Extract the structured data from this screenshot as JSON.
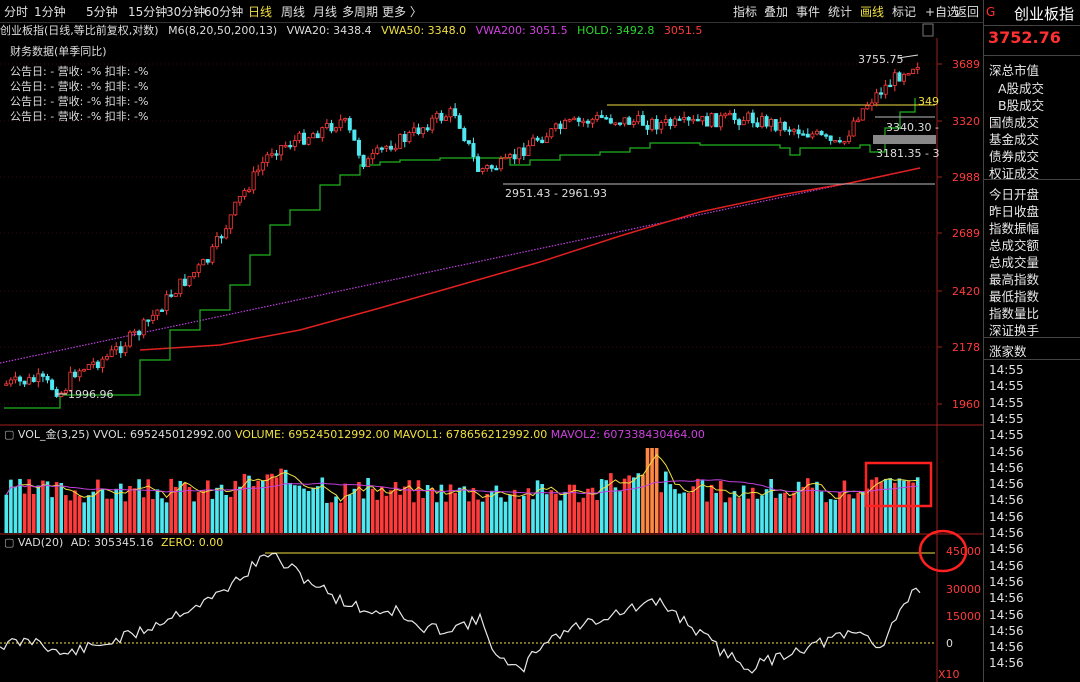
{
  "toolbar": {
    "periods": [
      "分时",
      "1分钟",
      "5分钟",
      "15分钟",
      "30分钟",
      "60分钟",
      "日线",
      "周线",
      "月线",
      "多周期",
      "更多 〉"
    ],
    "active_period": "日线",
    "right_items": [
      "指标",
      "叠加",
      "事件",
      "统计",
      "画线",
      "标记",
      "+自选",
      "返回"
    ],
    "active_right": "画线"
  },
  "main_chart": {
    "name": "创业板指(日线,等比前复权,对数)",
    "indicator": "M6(8,20,50,200,13)",
    "vwa20": "VWA20: 3438.4",
    "vwa50": "VWA50: 3348.0",
    "vwa200": "VWA200: 3051.5",
    "hold": "HOLD: 3492.8",
    "hold_extra": "3051.5",
    "fin_title": "财务数据(单季同比)",
    "fin_rows": [
      "公告日: -   营收: -%   扣非: -%",
      "公告日: -   营收: -%   扣非: -%",
      "公告日: -   营收: -%   扣非: -%",
      "公告日: -   营收: -%   扣非: -%"
    ],
    "y_ticks": [
      "3689",
      "3320",
      "2988",
      "2689",
      "2420",
      "2178",
      "1960"
    ],
    "annotations": {
      "high": "3755.75",
      "low": "1996.96",
      "range1": "2951.43 - 2961.93",
      "range2": "3340.30 -",
      "range3": "3181.35 - 3",
      "level": "349"
    }
  },
  "vol_panel": {
    "name": "VOL_金(3,25)",
    "vvol": "VVOL: 695245012992.00",
    "volume": "VOLUME: 695245012992.00",
    "mavol1": "MAVOL1: 678656212992.00",
    "mavol2": "MAVOL2: 607338430464.00"
  },
  "vad_panel": {
    "name": "VAD(20)",
    "ad": "AD: 305345.16",
    "zero": "ZERO: 0.00",
    "y_ticks": [
      "45000",
      "30000",
      "15000",
      "0",
      "X10"
    ]
  },
  "sidebar": {
    "g_mark": "G",
    "title": "创业板指",
    "price": "3752.76",
    "items": [
      "深总市值",
      "A股成交",
      "B股成交",
      "国债成交",
      "基金成交",
      "债券成交",
      "权证成交",
      "今日开盘",
      "昨日收盘",
      "指数振幅",
      "总成交额",
      "总成交量",
      "最高指数",
      "最低指数",
      "指数量比",
      "深证换手",
      "涨家数"
    ],
    "times": [
      "14:55",
      "14:55",
      "14:55",
      "14:55",
      "14:55",
      "14:56",
      "14:56",
      "14:56",
      "14:56",
      "14:56",
      "14:56",
      "14:56",
      "14:56",
      "14:56",
      "14:56",
      "14:56",
      "14:56",
      "14:56",
      "14:56"
    ]
  },
  "colors": {
    "up": "#ff3b3b",
    "down": "#4ee8f0",
    "ma_green": "#1fb31f",
    "ma_red": "#e02020",
    "ma_purple": "#c040e0",
    "yellow": "#f0e040"
  }
}
